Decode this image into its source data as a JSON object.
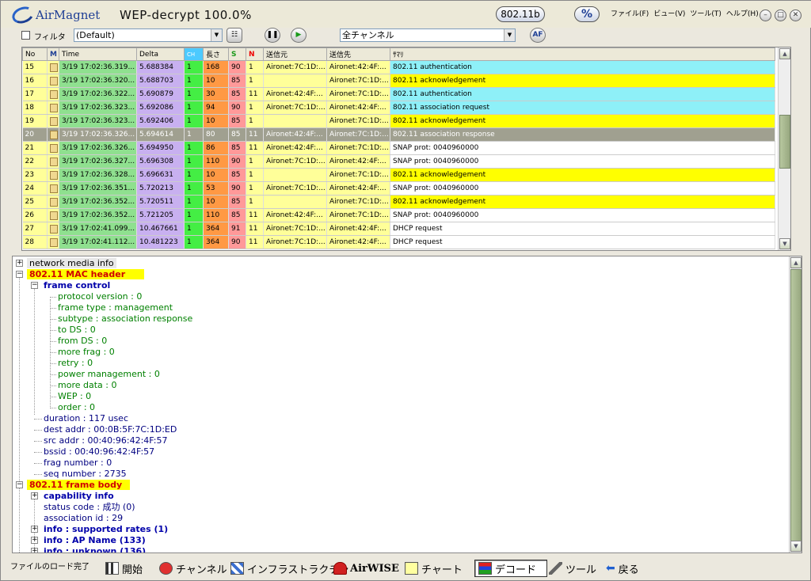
{
  "app": {
    "brand": "AirMagnet",
    "title": "WEP-decrypt 100.0%",
    "standard": "802.11b",
    "percent_button": "%",
    "menu": [
      "ファイル(F)",
      "ビュー(V)",
      "ツール(T)",
      "ヘルプ(H)"
    ]
  },
  "toolbar": {
    "filter_label": "フィルタ",
    "filter_value": "(Default)",
    "channel_value": "全チャンネル",
    "af_label": "AF"
  },
  "table": {
    "columns": [
      "No",
      "M",
      "Time",
      "Delta",
      "CH",
      "長さ",
      "S",
      "N",
      "送信元",
      "送信先",
      "ｻﾏﾘ"
    ],
    "rows": [
      {
        "no": "15",
        "time": "3/19 17:02:36.319...",
        "delta": "5.688384",
        "ch": "1",
        "len": "168",
        "sig": "90",
        "noise": "1",
        "src": "Aironet:7C:1D:...",
        "dst": "Aironet:42:4F:...",
        "summary": "802.11 authentication",
        "color": "cyan"
      },
      {
        "no": "16",
        "time": "3/19 17:02:36.320...",
        "delta": "5.688703",
        "ch": "1",
        "len": "10",
        "sig": "85",
        "noise": "1",
        "src": "",
        "dst": "Aironet:7C:1D:...",
        "summary": "802.11 acknowledgement",
        "color": "yellow"
      },
      {
        "no": "17",
        "time": "3/19 17:02:36.322...",
        "delta": "5.690879",
        "ch": "1",
        "len": "30",
        "sig": "85",
        "noise": "11",
        "src": "Aironet:42:4F:...",
        "dst": "Aironet:7C:1D:...",
        "summary": "802.11 authentication",
        "color": "cyan"
      },
      {
        "no": "18",
        "time": "3/19 17:02:36.323...",
        "delta": "5.692086",
        "ch": "1",
        "len": "94",
        "sig": "90",
        "noise": "1",
        "src": "Aironet:7C:1D:...",
        "dst": "Aironet:42:4F:...",
        "summary": "802.11 association request",
        "color": "cyan"
      },
      {
        "no": "19",
        "time": "3/19 17:02:36.323...",
        "delta": "5.692406",
        "ch": "1",
        "len": "10",
        "sig": "85",
        "noise": "1",
        "src": "",
        "dst": "Aironet:7C:1D:...",
        "summary": "802.11 acknowledgement",
        "color": "yellow"
      },
      {
        "no": "20",
        "time": "3/19 17:02:36.326...",
        "delta": "5.694614",
        "ch": "1",
        "len": "80",
        "sig": "85",
        "noise": "11",
        "src": "Aironet:42:4F:...",
        "dst": "Aironet:7C:1D:...",
        "summary": "802.11 association response",
        "color": "selected"
      },
      {
        "no": "21",
        "time": "3/19 17:02:36.326...",
        "delta": "5.694950",
        "ch": "1",
        "len": "86",
        "sig": "85",
        "noise": "11",
        "src": "Aironet:42:4F:...",
        "dst": "Aironet:7C:1D:...",
        "summary": "SNAP prot: 0040960000",
        "color": "white"
      },
      {
        "no": "22",
        "time": "3/19 17:02:36.327...",
        "delta": "5.696308",
        "ch": "1",
        "len": "110",
        "sig": "90",
        "noise": "1",
        "src": "Aironet:7C:1D:...",
        "dst": "Aironet:42:4F:...",
        "summary": "SNAP prot: 0040960000",
        "color": "white"
      },
      {
        "no": "23",
        "time": "3/19 17:02:36.328...",
        "delta": "5.696631",
        "ch": "1",
        "len": "10",
        "sig": "85",
        "noise": "1",
        "src": "",
        "dst": "Aironet:7C:1D:...",
        "summary": "802.11 acknowledgement",
        "color": "yellow"
      },
      {
        "no": "24",
        "time": "3/19 17:02:36.351...",
        "delta": "5.720213",
        "ch": "1",
        "len": "53",
        "sig": "90",
        "noise": "1",
        "src": "Aironet:7C:1D:...",
        "dst": "Aironet:42:4F:...",
        "summary": "SNAP prot: 0040960000",
        "color": "white"
      },
      {
        "no": "25",
        "time": "3/19 17:02:36.352...",
        "delta": "5.720511",
        "ch": "1",
        "len": "10",
        "sig": "85",
        "noise": "1",
        "src": "",
        "dst": "Aironet:7C:1D:...",
        "summary": "802.11 acknowledgement",
        "color": "yellow"
      },
      {
        "no": "26",
        "time": "3/19 17:02:36.352...",
        "delta": "5.721205",
        "ch": "1",
        "len": "110",
        "sig": "85",
        "noise": "11",
        "src": "Aironet:42:4F:...",
        "dst": "Aironet:7C:1D:...",
        "summary": "SNAP prot: 0040960000",
        "color": "white"
      },
      {
        "no": "27",
        "time": "3/19 17:02:41.099...",
        "delta": "10.467661",
        "ch": "1",
        "len": "364",
        "sig": "91",
        "noise": "11",
        "src": "Aironet:7C:1D:...",
        "dst": "Aironet:42:4F:...",
        "summary": "DHCP request",
        "color": "white"
      },
      {
        "no": "28",
        "time": "3/19 17:02:41.112...",
        "delta": "10.481223",
        "ch": "1",
        "len": "364",
        "sig": "90",
        "noise": "11",
        "src": "Aironet:7C:1D:...",
        "dst": "Aironet:42:4F:...",
        "summary": "DHCP request",
        "color": "white"
      }
    ]
  },
  "tree": {
    "network_media_info": "network media info",
    "mac_header": "802.11 MAC header",
    "frame_control": "frame control",
    "fc_items": [
      "protocol version : 0",
      "frame type : management",
      "subtype : association response",
      "to DS : 0",
      "from DS : 0",
      "more frag : 0",
      "retry : 0",
      "power management : 0",
      "more data : 0",
      "WEP : 0",
      "order : 0"
    ],
    "mac_items": [
      "duration : 117 usec",
      "dest addr : 00:0B:5F:7C:1D:ED",
      "src  addr : 00:40:96:42:4F:57",
      "bssid : 00:40:96:42:4F:57",
      "frag number : 0",
      "seq number : 2735"
    ],
    "frame_body": "802.11 frame body",
    "capability_info": "capability info",
    "body_items": [
      "status code : 成功 (0)",
      "association id : 29"
    ],
    "info_nodes": [
      "info : supported rates (1)",
      "info : AP Name (133)",
      "info : unknown (136)"
    ]
  },
  "statusbar": {
    "status": "ファイルのロード完了",
    "nav": [
      "開始",
      "チャンネル",
      "インフラストラクチャ",
      "AirWISE",
      "チャート",
      "デコード",
      "ツール",
      "戻る"
    ]
  }
}
